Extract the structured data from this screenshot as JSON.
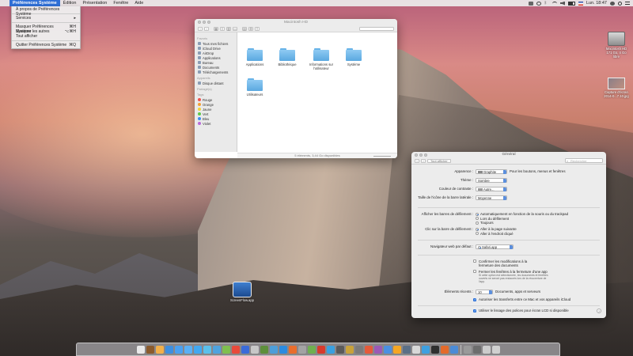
{
  "menubar": {
    "app_name": "Préférences Système",
    "items": [
      "Édition",
      "Présentation",
      "Fenêtre",
      "Aide"
    ],
    "clock": "Lun. 18:47"
  },
  "app_menu": {
    "items": [
      {
        "label": "À propos de Préférences Système",
        "shortcut": ""
      },
      {
        "label": "Services",
        "shortcut": "▸"
      },
      {
        "label": "Masquer Préférences Système",
        "shortcut": "⌘H"
      },
      {
        "label": "Masquer les autres",
        "shortcut": "⌥⌘H"
      },
      {
        "label": "Tout afficher",
        "shortcut": ""
      },
      {
        "label": "Quitter Préférences Système",
        "shortcut": "⌘Q"
      }
    ]
  },
  "desktop": {
    "hd_label": "Macintosh HD",
    "hd_sub": "171 Go, 4 Go libre",
    "screenshot_label": "Capture d'écran",
    "screenshot_sub": "2014-0...7.10.jpg",
    "screenflow_label": "ScreenFlow.app"
  },
  "finder": {
    "title": "Macintosh HD",
    "sidebar": {
      "favorites_head": "Favoris",
      "favorites": [
        "Tous mes fichiers",
        "iCloud Drive",
        "AirDrop",
        "Applications",
        "Bureau",
        "Documents",
        "Téléchargements"
      ],
      "devices_head": "Appareils",
      "devices": [
        "Disque distant"
      ],
      "shared_head": "Partagé(s)",
      "tags_head": "Tags",
      "tags": [
        {
          "label": "Rouge",
          "color": "#f0524d"
        },
        {
          "label": "Orange",
          "color": "#f5a033"
        },
        {
          "label": "Jaune",
          "color": "#f3d23c"
        },
        {
          "label": "Vert",
          "color": "#5ec94b"
        },
        {
          "label": "Bleu",
          "color": "#3f8df0"
        },
        {
          "label": "Violet",
          "color": "#b96ad9"
        }
      ]
    },
    "files": [
      "Applications",
      "Bibliothèque",
      "Informations sur l'utilisateur",
      "Système",
      "Utilisateurs"
    ],
    "status": "5 éléments, 3,44 Go disponibles"
  },
  "prefs": {
    "title": "Général",
    "show_all": "Tout afficher",
    "search_placeholder": "Rechercher",
    "appearance": {
      "label": "Apparence :",
      "value": "Graphite",
      "note": "Pour les boutons, menus et fenêtres"
    },
    "theme": {
      "label": "Thème :",
      "value": "Sombre"
    },
    "highlight": {
      "label": "Couleur de contraste :",
      "value": "Autre..."
    },
    "sidebar_size": {
      "label": "Taille de l'icône de la barre latérale :",
      "value": "Moyenne"
    },
    "scrollbars": {
      "label": "Afficher les barres de défilement :",
      "options": [
        {
          "label": "Automatiquement en fonction de la souris ou du trackpad",
          "on": true
        },
        {
          "label": "Lors du défilement",
          "on": false
        },
        {
          "label": "Toujours",
          "on": false
        }
      ]
    },
    "click_scroll": {
      "label": "Clic sur la barre de défilement :",
      "options": [
        {
          "label": "Aller à la page suivante",
          "on": true
        },
        {
          "label": "Aller à l'endroit cliqué",
          "on": false
        }
      ]
    },
    "browser": {
      "label": "Navigateur web par défaut :",
      "value": "Safari.app"
    },
    "confirm_changes": {
      "label": "Confirmer les modifications à la fermeture des documents",
      "on": false
    },
    "close_windows": {
      "label": "Fermer les fenêtres à la fermeture d'une app",
      "on": false
    },
    "close_note": "Si cette option est sélectionnée, les documents et fenêtres ouverts ne seront pas restaurés lors de la réouverture de l'app.",
    "recent": {
      "label": "Éléments récents :",
      "value": "10",
      "suffix": "Documents, apps et serveurs"
    },
    "handoff": {
      "label": "Autoriser les transferts entre ce Mac et vos appareils iCloud",
      "on": true
    },
    "lcd": {
      "label": "Utiliser le lissage des polices pour écran LCD si disponible",
      "on": true
    },
    "help": "?"
  },
  "dock": {
    "apps": [
      "#e9e9e9",
      "#8a5a2c",
      "#f2b04a",
      "#3d8fe0",
      "#4aa0f0",
      "#5ab0f5",
      "#42a8f0",
      "#5bc0eb",
      "#4fa3de",
      "#7fbf4f",
      "#e84a3b",
      "#3b6bd9",
      "#c7c7c7",
      "#5d8f3a",
      "#4d9ed9",
      "#2b8be0",
      "#e96d2c",
      "#a3a3a3",
      "#6fb04f",
      "#d93a2c",
      "#3aa0e0",
      "#5a5a5a",
      "#c9a23a",
      "#7b7b7b",
      "#e55a3a",
      "#9b59b6",
      "#4a90e2",
      "#f5a623",
      "#5b6f86",
      "#d8d8d8",
      "#3ea0e0",
      "#2f2f2f",
      "#e46a2a",
      "#4b8bd6",
      "#9a9a9a",
      "#6d6d6d",
      "#cccccc",
      "#d0d0d0"
    ]
  }
}
